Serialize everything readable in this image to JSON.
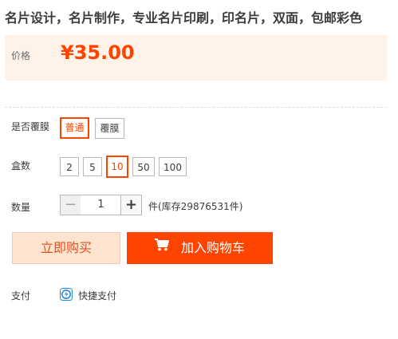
{
  "product": {
    "title": "名片设计，名片制作，专业名片印刷，印名片，双面，包邮彩色"
  },
  "price": {
    "label": "价格",
    "value": "¥35.00"
  },
  "lamination": {
    "label": "是否覆膜",
    "options": [
      "普通",
      "覆膜"
    ],
    "selected": "普通"
  },
  "boxes": {
    "label": "盒数",
    "options": [
      "2",
      "5",
      "10",
      "50",
      "100"
    ],
    "selected": "10"
  },
  "quantity": {
    "label": "数量",
    "value": "1",
    "minus": "−",
    "plus": "+",
    "stock_text": "件(库存29876531件)"
  },
  "actions": {
    "buy_now": "立即购买",
    "add_to_cart": "加入购物车"
  },
  "payment": {
    "label": "支付",
    "method": "快捷支付"
  },
  "colors": {
    "accent": "#ff4400",
    "price_bg": "#fff2e8"
  },
  "icons": [
    "cart-icon",
    "quick-pay-icon"
  ]
}
